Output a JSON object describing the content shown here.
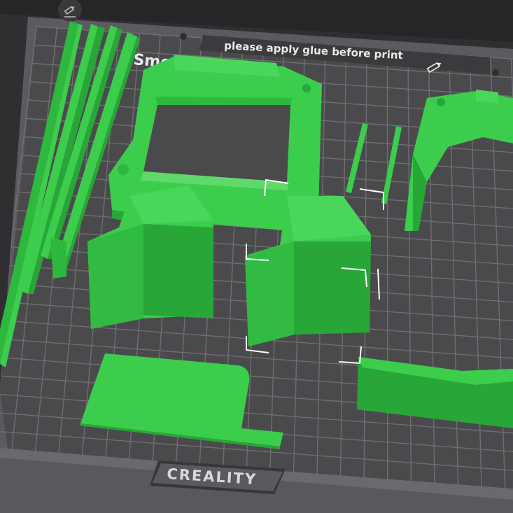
{
  "bed": {
    "notice_text": "please apply glue before print",
    "plate_label": "Smooth PEI Pl",
    "brand_text": "CREALITY"
  },
  "icons": {
    "top_tool": "pencil-icon",
    "notice_edit": "pencil-icon"
  },
  "colors": {
    "background": "#3f3f42",
    "bed_surface": "#4a4a4d",
    "grid_line": "#6f6f73",
    "model_green": "#3ccd4c",
    "model_green_dark": "#28a637",
    "selection_bracket": "#ffffff"
  },
  "models": [
    "rail-strips",
    "frame",
    "pins",
    "right-bracket",
    "left-block",
    "center-block",
    "flat-plate",
    "right-bar"
  ]
}
